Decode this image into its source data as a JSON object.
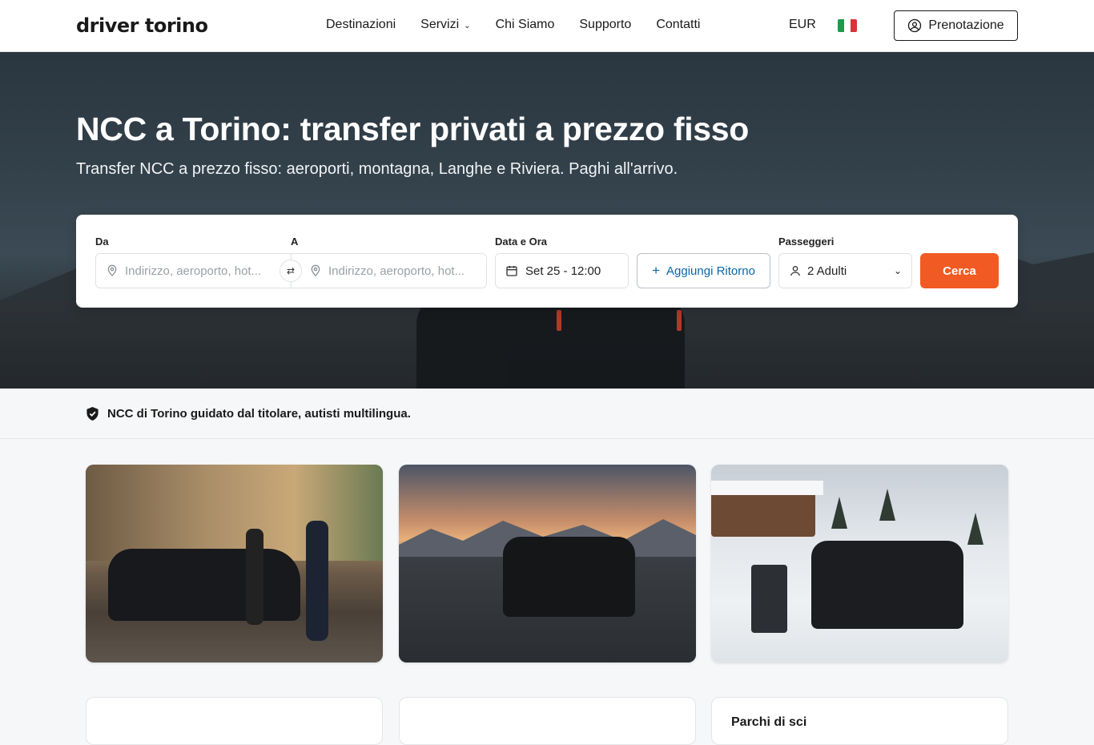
{
  "brand": {
    "logo": "driver torino"
  },
  "nav": {
    "items": [
      {
        "label": "Destinazioni",
        "dropdown": false
      },
      {
        "label": "Servizi",
        "dropdown": true
      },
      {
        "label": "Chi Siamo",
        "dropdown": false
      },
      {
        "label": "Supporto",
        "dropdown": false
      },
      {
        "label": "Contatti",
        "dropdown": false
      }
    ],
    "currency": "EUR",
    "language_flag": "italy-flag-icon",
    "booking_button": "Prenotazione"
  },
  "hero": {
    "title": "NCC a Torino: transfer privati a prezzo fisso",
    "subtitle": "Transfer NCC a prezzo fisso: aeroporti, montagna, Langhe e Riviera. Paghi all'arrivo."
  },
  "search": {
    "from_label": "Da",
    "from_placeholder": "Indirizzo, aeroporto, hot...",
    "to_label": "A",
    "to_placeholder": "Indirizzo, aeroporto, hot...",
    "date_label": "Data e Ora",
    "date_value": "Set 25 - 12:00",
    "return_button": "Aggiungi Ritorno",
    "passengers_label": "Passeggeri",
    "passengers_value": "2 Adulti",
    "search_button": "Cerca"
  },
  "trust": {
    "text": "NCC di Torino guidato dal titolare, autisti multilingua."
  },
  "cards": [
    {
      "image": "chauffeur-sedan-photo"
    },
    {
      "image": "van-mountain-road-photo"
    },
    {
      "image": "van-snow-ski-photo",
      "title": "Parchi di sci"
    }
  ],
  "colors": {
    "accent": "#f15a22",
    "link": "#0b66a8",
    "text": "#1a1a1a"
  }
}
